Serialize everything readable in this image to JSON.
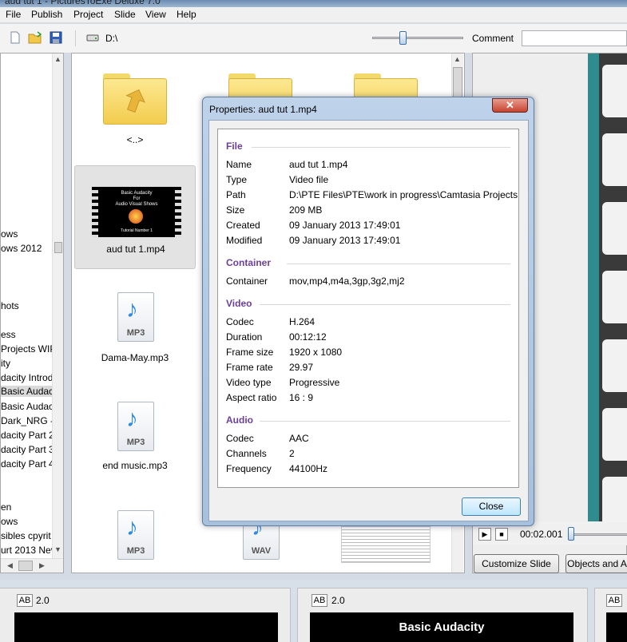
{
  "window": {
    "title": "aud tut 1 - PicturesToExe Deluxe 7.0"
  },
  "menu": [
    "File",
    "Publish",
    "Project",
    "Slide",
    "View",
    "Help"
  ],
  "toolbar": {
    "path": "D:\\",
    "comment_label": "Comment",
    "comment_value": ""
  },
  "tree": {
    "items": [
      "ows",
      "ows 2012",
      "hots",
      "ess",
      "Projects WIP",
      "ity",
      "dacity Introd",
      "Basic Audac",
      "Basic Audac",
      "Dark_NRG -",
      "dacity Part 2",
      "dacity Part 3",
      "dacity Part 4",
      "en",
      "ows",
      "sibles cpyrit",
      "urt 2013 Nev"
    ]
  },
  "files": {
    "items": [
      {
        "name": "<..>",
        "type": "up-folder"
      },
      {
        "name": "",
        "type": "folder"
      },
      {
        "name": "",
        "type": "folder"
      },
      {
        "name": "aud tut 1.mp4",
        "type": "video",
        "selected": true
      },
      {
        "name": "Dama-May.mp3",
        "type": "mp3"
      },
      {
        "name": "end music.mp3",
        "type": "mp3"
      },
      {
        "name": "",
        "type": "mp3"
      },
      {
        "name": "",
        "type": "wav"
      }
    ],
    "video_thumb": {
      "line1": "Basic Audacity",
      "line2": "For",
      "line3": "Audio Visual Shows",
      "line4": "Tutorial Number 1"
    },
    "wav_label": "WAV",
    "mp3_label": "MP3"
  },
  "preview": {
    "time": "00:02.001"
  },
  "buttons": {
    "customize": "Customize Slide",
    "objects": "Objects and A"
  },
  "slides": [
    {
      "ab": "AB",
      "duration": "2.0",
      "caption": ""
    },
    {
      "ab": "AB",
      "duration": "2.0",
      "caption": "Basic Audacity"
    },
    {
      "ab": "AB",
      "duration": "",
      "caption": ""
    }
  ],
  "dialog": {
    "title": "Properties: aud tut 1.mp4",
    "close_label": "Close",
    "sections": {
      "file": {
        "heading": "File",
        "rows": [
          {
            "label": "Name",
            "value": "aud tut 1.mp4"
          },
          {
            "label": "Type",
            "value": "Video file"
          },
          {
            "label": "Path",
            "value": "D:\\PTE Files\\PTE\\work in progress\\Camtasia Projects W"
          },
          {
            "label": "Size",
            "value": "209 MB"
          },
          {
            "label": "Created",
            "value": "09 January 2013  17:49:01"
          },
          {
            "label": "Modified",
            "value": "09 January 2013  17:49:01"
          }
        ]
      },
      "container": {
        "heading": "Container",
        "rows": [
          {
            "label": "Container",
            "value": "mov,mp4,m4a,3gp,3g2,mj2"
          }
        ]
      },
      "video": {
        "heading": "Video",
        "rows": [
          {
            "label": "Codec",
            "value": "H.264"
          },
          {
            "label": "Duration",
            "value": "00:12:12"
          },
          {
            "label": "Frame size",
            "value": "1920 x 1080"
          },
          {
            "label": "Frame rate",
            "value": "29.97"
          },
          {
            "label": "Video type",
            "value": "Progressive"
          },
          {
            "label": "Aspect ratio",
            "value": "16 : 9"
          }
        ]
      },
      "audio": {
        "heading": "Audio",
        "rows": [
          {
            "label": "Codec",
            "value": "AAC"
          },
          {
            "label": "Channels",
            "value": "2"
          },
          {
            "label": "Frequency",
            "value": "44100Hz"
          }
        ]
      }
    }
  },
  "colors": {
    "section_heading": "#6b3f9a",
    "dialog_frame": "#a6c0dd",
    "close_x": "#c7432f"
  }
}
